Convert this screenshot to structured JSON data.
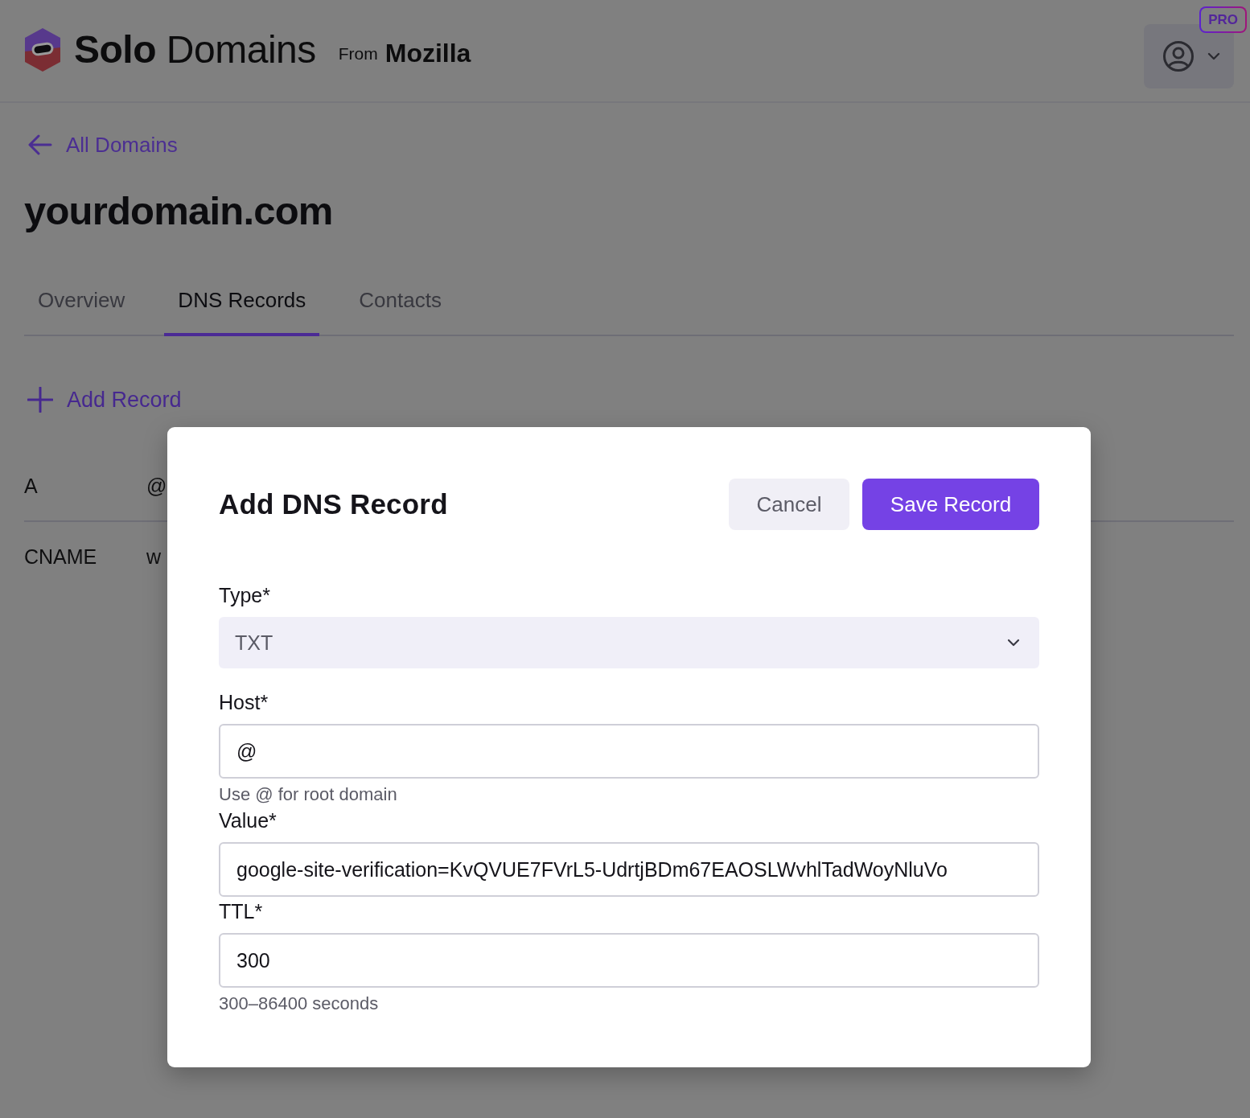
{
  "header": {
    "logo_text": "**Solo** Domains",
    "from": "From",
    "brand": "Mozilla",
    "badge": "PRO"
  },
  "back_link": "All Domains",
  "domain": "yourdomain.com",
  "tabs": [
    {
      "label": "Overview",
      "selected": false
    },
    {
      "label": "DNS Records",
      "selected": true
    },
    {
      "label": "Contacts",
      "selected": false
    }
  ],
  "add_record": "Add Record",
  "records": [
    {
      "type": "A",
      "host": "@"
    },
    {
      "type": "CNAME",
      "host": "w"
    }
  ],
  "dialog": {
    "title": "Add DNS Record",
    "buttons": [
      {
        "label": "Cancel",
        "kind": "secondary"
      },
      {
        "label": "Save Record",
        "kind": "primary"
      }
    ],
    "fields": [
      {
        "label": "Type*",
        "kind": "select",
        "value": "TXT"
      },
      {
        "label": "Host*",
        "kind": "input",
        "value": "@",
        "hint": "Use @ for root domain"
      },
      {
        "label": "Value*",
        "kind": "input",
        "value": "google-site-verification=KvQVUE7FVrL5-UdrtjBDm67EAOSLWvhlTadWoyNluVo"
      },
      {
        "label": "TTL*",
        "kind": "input",
        "value": "300",
        "hint": "300–86400 seconds"
      }
    ]
  }
}
